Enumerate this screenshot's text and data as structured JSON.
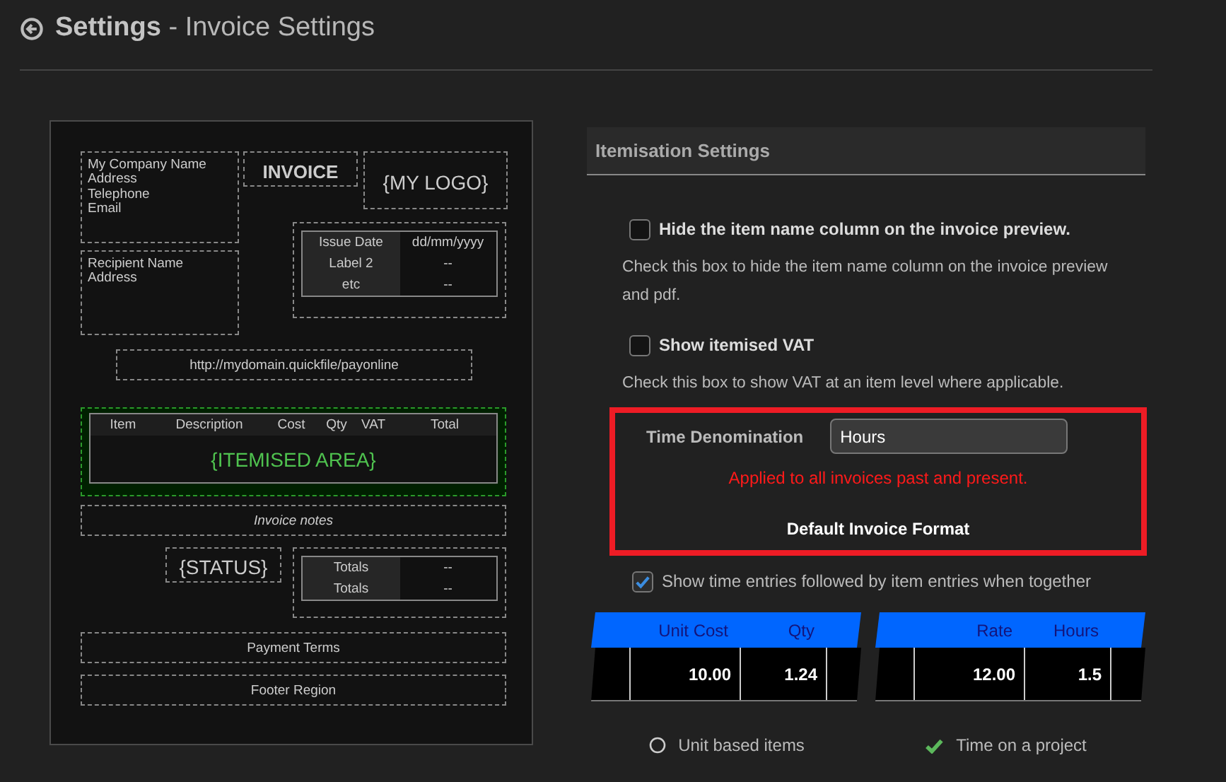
{
  "header": {
    "title": "**Settings** - Invoice Settings"
  },
  "invoice_preview": {
    "company_lines": [
      "My Company Name",
      "Address",
      "Telephone",
      "Email"
    ],
    "invoice_title": "INVOICE",
    "logo": "{MY LOGO}",
    "recipient_lines": [
      "Recipient Name",
      "Address"
    ],
    "details": [
      {
        "label": "Issue Date",
        "value": "dd/mm/yyyy"
      },
      {
        "label": "Label 2",
        "value": "--"
      },
      {
        "label": "etc",
        "value": "--"
      }
    ],
    "pay_link": "http://mydomain.quickfile/payonline",
    "item_columns": [
      "Item",
      "Description",
      "Cost",
      "Qty",
      "VAT",
      "Total"
    ],
    "itemised_placeholder": "{ITEMISED AREA}",
    "notes": "Invoice notes",
    "status": "{STATUS}",
    "totals": [
      {
        "label": "Totals",
        "value": "--"
      },
      {
        "label": "Totals",
        "value": "--"
      }
    ],
    "payment_terms": "Payment Terms",
    "footer": "Footer Region"
  },
  "settings": {
    "heading": "Itemisation Settings",
    "options": [
      {
        "label": "Hide the item name column on the invoice preview.",
        "checked": false,
        "description": "Check this box to hide the item name column on the invoice preview and pdf."
      },
      {
        "label": "Show itemised VAT",
        "checked": false,
        "description": "Check this box to show VAT at an item level where applicable."
      }
    ],
    "time_denomination": {
      "label": "Time Denomination",
      "value": "Hours",
      "warning": "Applied to all invoices past and present."
    },
    "format_heading": "Default Invoice Format",
    "order_option": {
      "label": "Show time entries followed by item entries when together",
      "checked": true
    },
    "formats": [
      {
        "columns": [
          "Unit Cost",
          "Qty"
        ],
        "values": [
          "10.00",
          "1.24"
        ],
        "label": "Unit based items",
        "selected": false
      },
      {
        "columns": [
          "Rate",
          "Hours"
        ],
        "values": [
          "12.00",
          "1.5"
        ],
        "label": "Time on a project",
        "selected": true
      }
    ]
  }
}
